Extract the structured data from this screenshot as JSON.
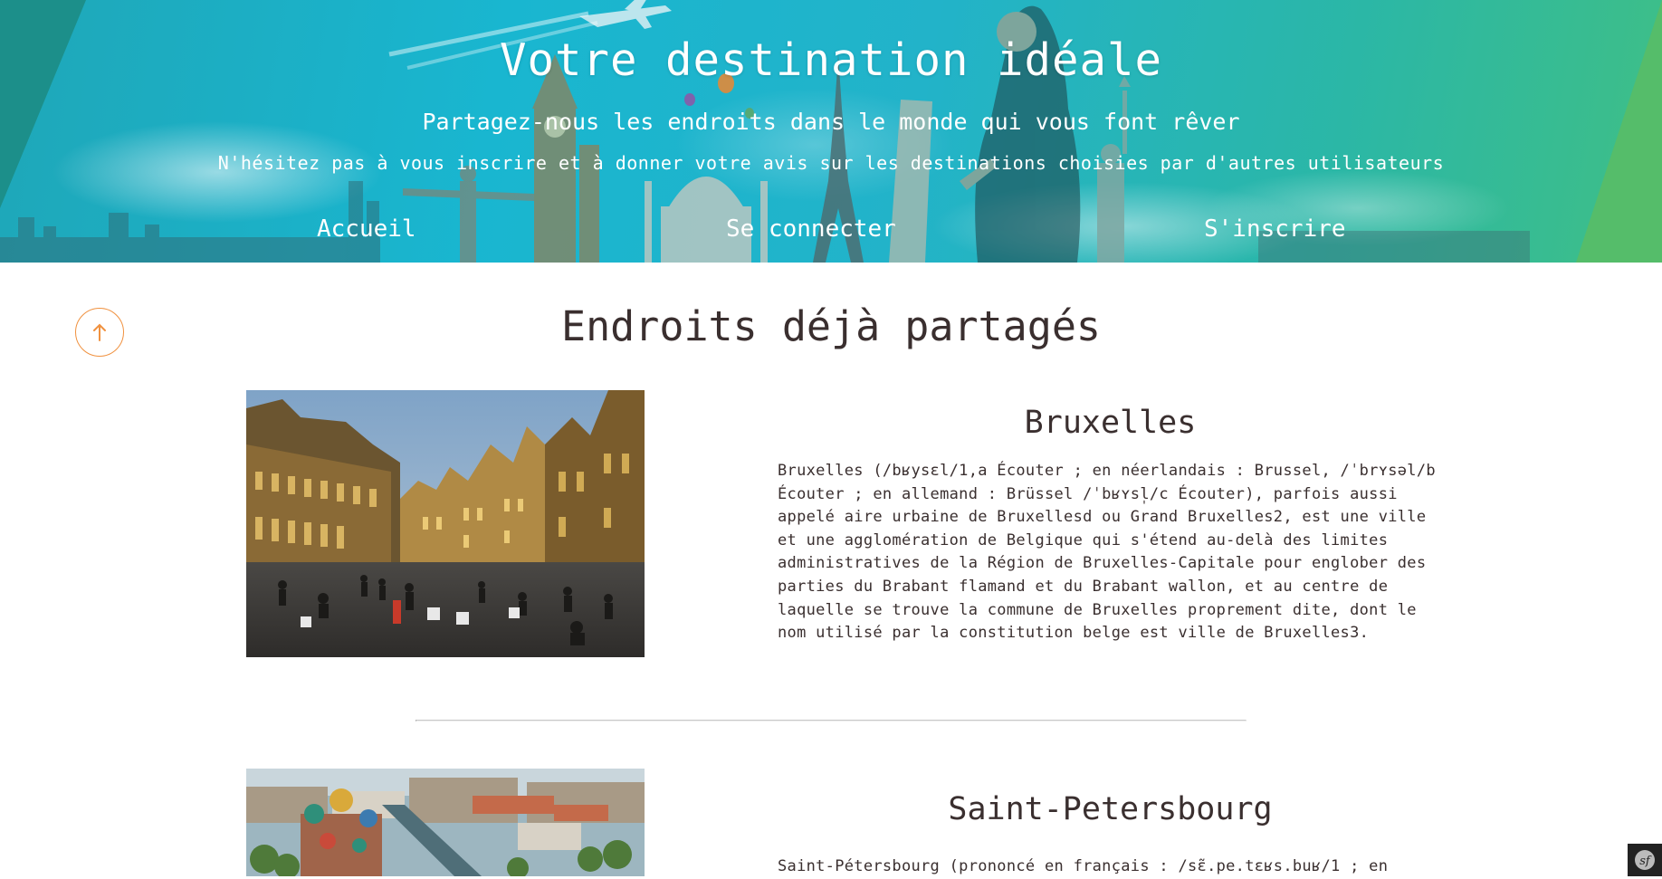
{
  "hero": {
    "title": "Votre destination idéale",
    "subtitle": "Partagez-nous les endroits dans le monde qui vous font rêver",
    "tagline": "N'hésitez pas à vous inscrire et à donner votre avis sur les destinations choisies par d'autres utilisateurs"
  },
  "nav": {
    "items": [
      {
        "label": "Accueil"
      },
      {
        "label": "Se connecter"
      },
      {
        "label": "S'inscrire"
      }
    ]
  },
  "main": {
    "title": "Endroits déjà partagés",
    "scroll_top_icon": "arrow-up-icon",
    "places": [
      {
        "name": "Bruxelles",
        "description": "Bruxelles (/bʁysɛl/1,a Écouter ; en néerlandais : Brussel, /ˈbrʏsəl/b Écouter ; en allemand : Brüssel /ˈbʁʏsl̩/c Écouter), parfois aussi appelé aire urbaine de Bruxellesd ou Grand Bruxelles2, est une ville et une agglomération de Belgique qui s'étend au-delà des limites administratives de la Région de Bruxelles-Capitale pour englober des parties du Brabant flamand et du Brabant wallon, et au centre de laquelle se trouve la commune de Bruxelles proprement dite, dont le nom utilisé par la constitution belge est ville de Bruxelles3."
      },
      {
        "name": "Saint-Petersbourg",
        "description": "Saint-Pétersbourg (prononcé en français : /sɛ̃.pe.tɛʁs.buʁ/1 ; en"
      }
    ]
  },
  "colors": {
    "accent": "#f0913f",
    "text": "#3a2f2f",
    "hero_teal": "#19b6d0",
    "hero_green": "#55bd6a"
  },
  "toolbar": {
    "icon": "symfony-logo-icon"
  }
}
